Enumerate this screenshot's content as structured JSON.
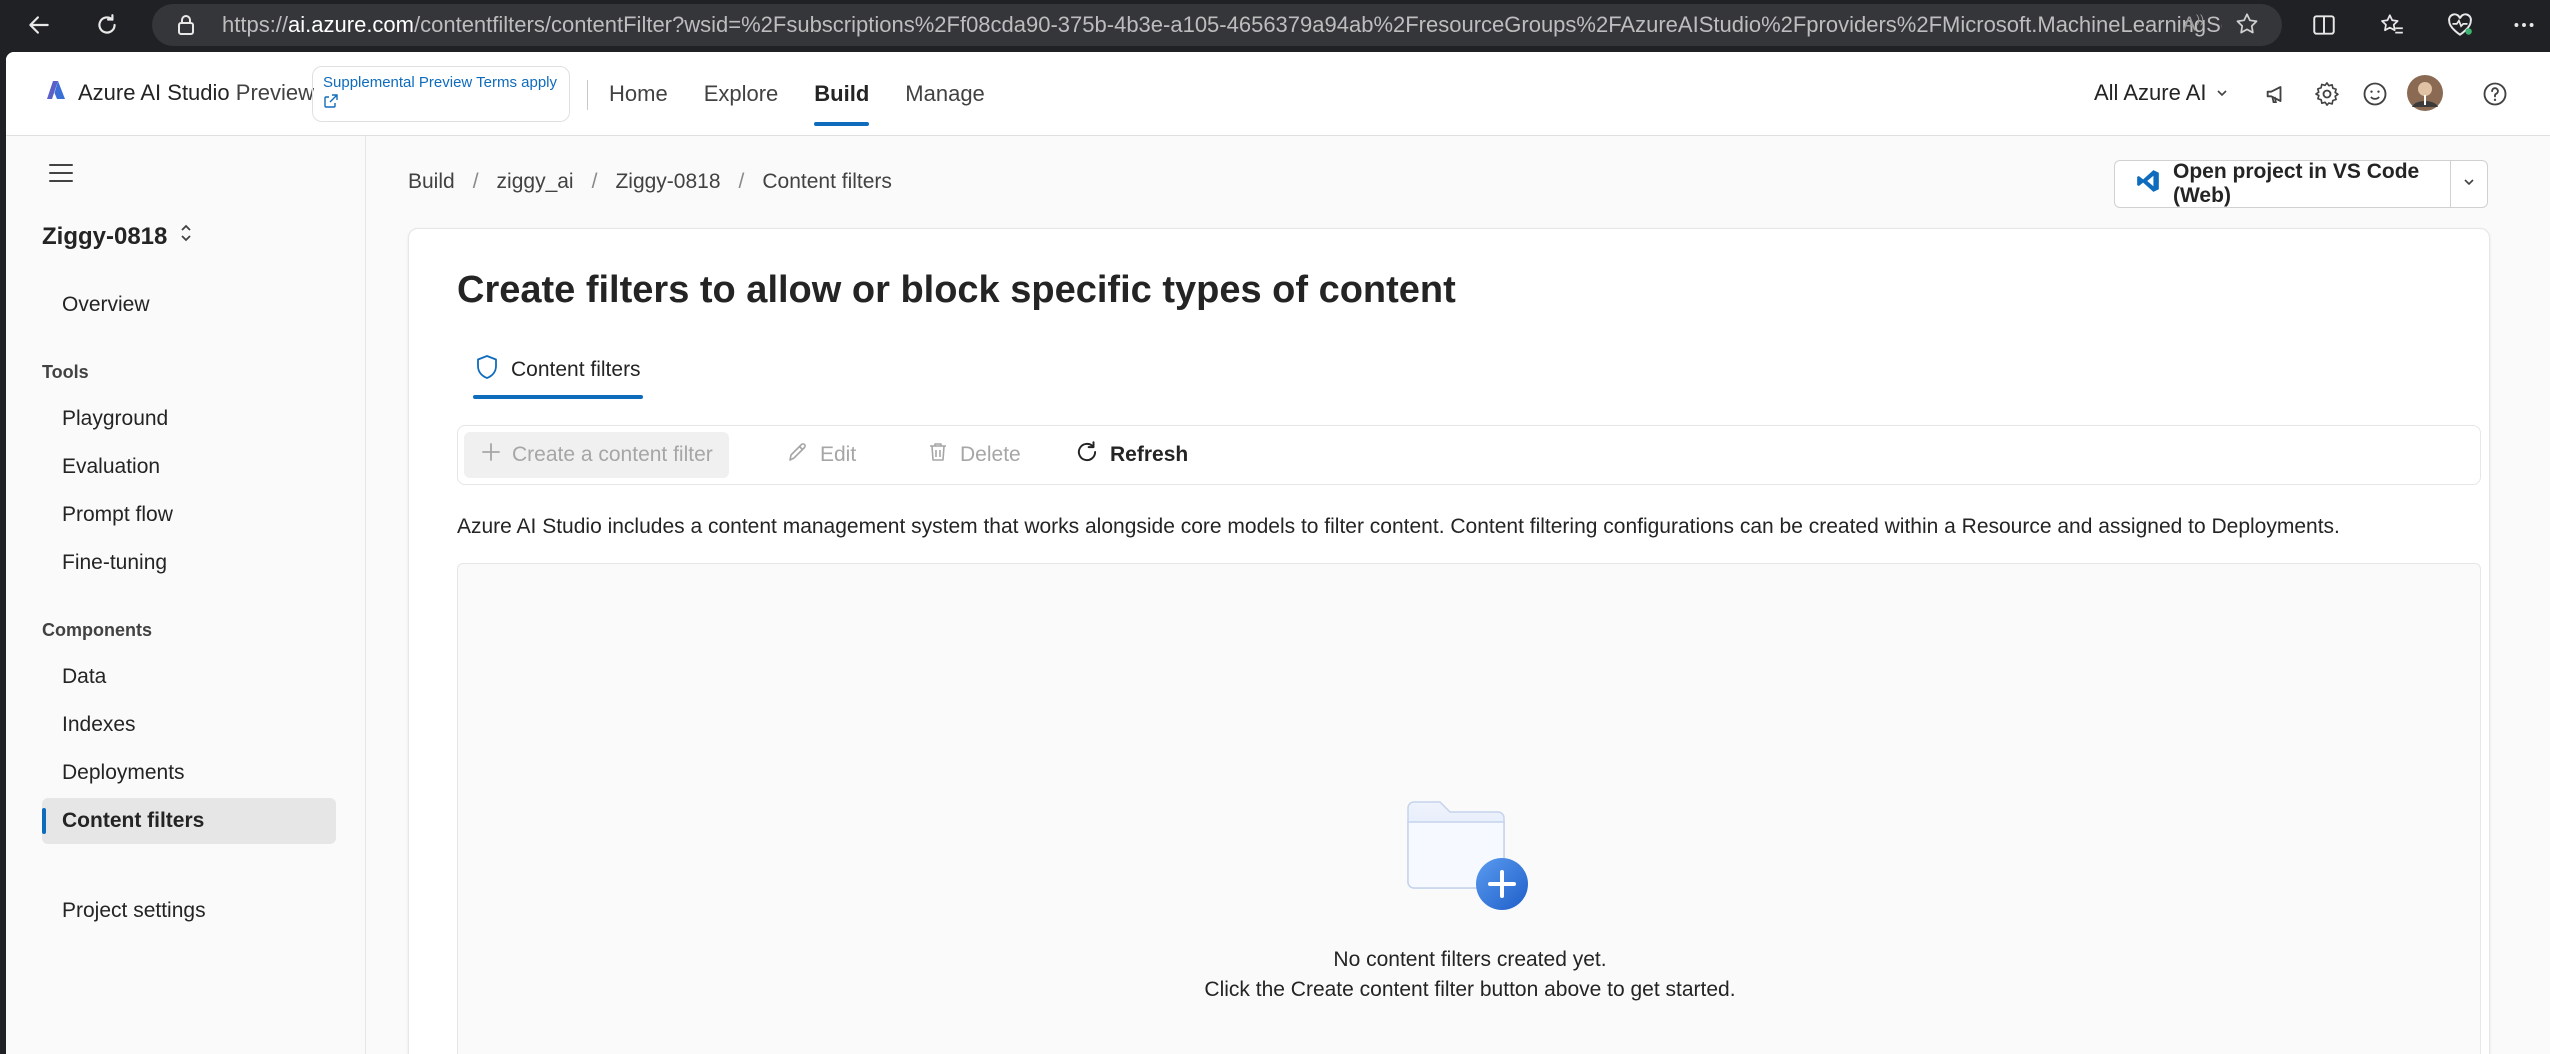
{
  "browser": {
    "url_prefix": "https://",
    "url_host": "ai.azure.com",
    "url_rest": "/contentfilters/contentFilter?wsid=%2Fsubscriptions%2Ff08cda90-375b-4b3e-a105-4656379a94ab%2FresourceGroups%2FAzureAIStudio%2Fproviders%2FMicrosoft.MachineLearningServi..."
  },
  "header": {
    "brand": "Azure AI Studio",
    "brand_suffix": "Preview",
    "preview_terms": "Supplemental Preview Terms apply",
    "nav": [
      {
        "label": "Home"
      },
      {
        "label": "Explore"
      },
      {
        "label": "Build"
      },
      {
        "label": "Manage"
      }
    ],
    "active_nav": "Build",
    "scope_selector": "All Azure AI"
  },
  "sidebar": {
    "project_name": "Ziggy-0818",
    "overview": "Overview",
    "tools_heading": "Tools",
    "tools": [
      "Playground",
      "Evaluation",
      "Prompt flow",
      "Fine-tuning"
    ],
    "components_heading": "Components",
    "components": [
      "Data",
      "Indexes",
      "Deployments",
      "Content filters"
    ],
    "active_item": "Content filters",
    "project_settings": "Project settings"
  },
  "breadcrumb": [
    "Build",
    "ziggy_ai",
    "Ziggy-0818",
    "Content filters"
  ],
  "vscode_button": "Open project in VS Code (Web)",
  "page": {
    "title": "Create filters to allow or block specific types of content",
    "tab": "Content filters",
    "toolbar": {
      "create": "Create a content filter",
      "edit": "Edit",
      "delete": "Delete",
      "refresh": "Refresh"
    },
    "description": "Azure AI Studio includes a content management system that works alongside core models to filter content. Content filtering configurations can be created within a Resource and assigned to Deployments.",
    "empty_line1": "No content filters created yet.",
    "empty_line2": "Click the Create content filter button above to get started."
  },
  "colors": {
    "accent": "#0f6cbd",
    "disabled_text": "#a6a6a6"
  }
}
